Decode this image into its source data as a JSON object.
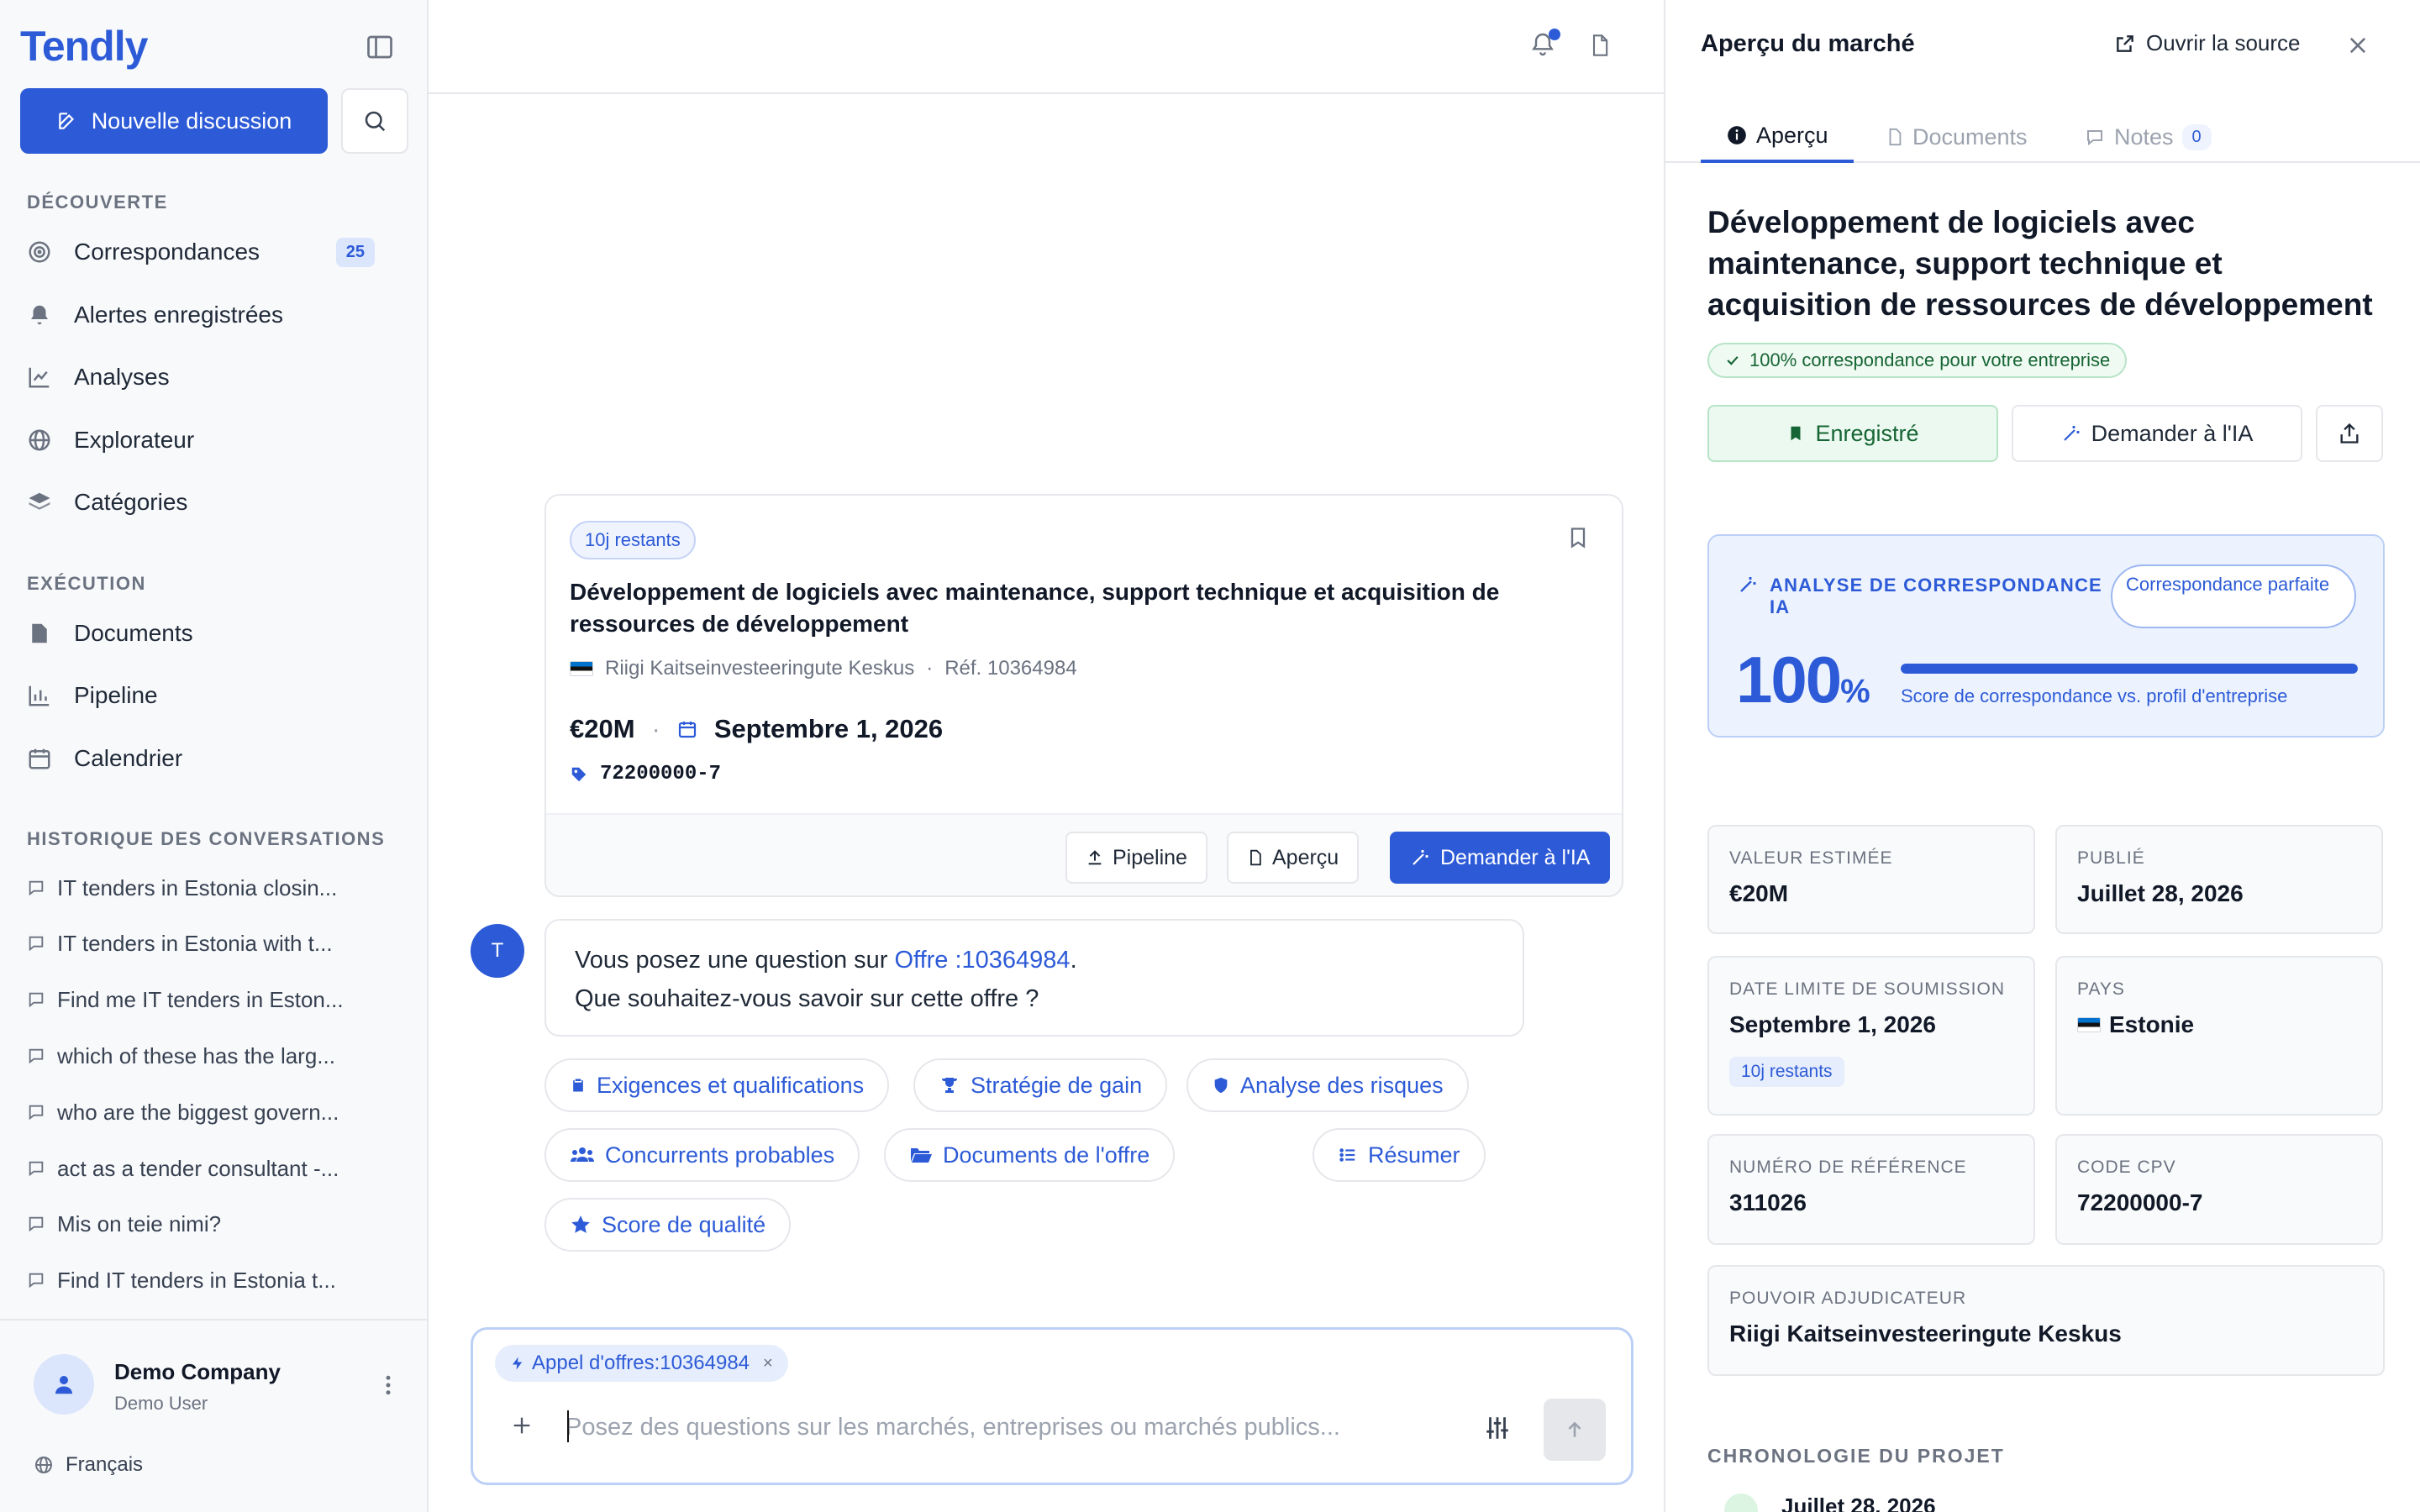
{
  "app": {
    "logo": "Tendly",
    "new_chat_label": "Nouvelle discussion"
  },
  "sidebar": {
    "discovery_heading": "DÉCOUVERTE",
    "discovery_items": [
      {
        "label": "Correspondances",
        "badge": "25"
      },
      {
        "label": "Alertes enregistrées"
      },
      {
        "label": "Analyses"
      },
      {
        "label": "Explorateur"
      },
      {
        "label": "Catégories"
      }
    ],
    "execution_heading": "EXÉCUTION",
    "execution_items": [
      {
        "label": "Documents"
      },
      {
        "label": "Pipeline"
      },
      {
        "label": "Calendrier"
      }
    ],
    "history_heading": "HISTORIQUE DES CONVERSATIONS",
    "history": [
      "IT tenders in Estonia closin...",
      "IT tenders in Estonia with t...",
      "Find me IT tenders in Eston...",
      "which of these has the larg...",
      "who are the biggest govern...",
      "act as a tender consultant -...",
      "Mis on teie nimi?",
      "Find IT tenders in Estonia t..."
    ],
    "footer": {
      "company": "Demo Company",
      "user": "Demo User",
      "language": "Français"
    }
  },
  "tender_card": {
    "days_left": "10j restants",
    "title": "Développement de logiciels avec maintenance, support technique et acquisition de ressources de développement",
    "buyer": "Riigi Kaitseinvesteeringute Keskus",
    "reference": "Réf. 10364984",
    "value": "€20M",
    "deadline": "Septembre 1, 2026",
    "cpv": "72200000-7",
    "actions": {
      "pipeline": "Pipeline",
      "preview": "Aperçu",
      "ask_ai": "Demander à l'IA"
    }
  },
  "message": {
    "avatar": "T",
    "line1_prefix": "Vous posez une question sur ",
    "link": "Offre :10364984",
    "line1_suffix": ".",
    "line2": "Que souhaitez-vous savoir sur cette offre ?"
  },
  "suggestions": [
    "Exigences et qualifications",
    "Stratégie de gain",
    "Analyse des risques",
    "Concurrents probables",
    "Documents de l'offre",
    "Résumer",
    "Score de qualité"
  ],
  "composer": {
    "chip": "Appel d'offres:10364984",
    "chip_close": "×",
    "placeholder": "Posez des questions sur les marchés, entreprises ou marchés publics...",
    "value": ""
  },
  "panel": {
    "title": "Aperçu du marché",
    "source_label": "Ouvrir la source",
    "tabs": [
      {
        "label": "Aperçu"
      },
      {
        "label": "Documents"
      },
      {
        "label": "Notes",
        "count": "0"
      }
    ],
    "tender_title": "Développement de logiciels avec maintenance, support technique et acquisition de ressources de développement",
    "match_badge": "100% correspondance pour votre entreprise",
    "saved_label": "Enregistré",
    "ask_label": "Demander à l'IA",
    "ai": {
      "label": "ANALYSE DE CORRESPONDANCE IA",
      "pill": "Correspondance parfaite",
      "score": "100",
      "unit": "%",
      "score_fraction": 1.0,
      "caption": "Score de correspondance vs. profil d'entreprise"
    },
    "facts": {
      "value_label": "VALEUR ESTIMÉE",
      "value": "€20M",
      "published_label": "PUBLIÉ",
      "published": "Juillet 28, 2026",
      "deadline_label": "DATE LIMITE DE SOUMISSION",
      "deadline": "Septembre 1, 2026",
      "deadline_pill": "10j restants",
      "country_label": "PAYS",
      "country": "Estonie",
      "ref_label": "NUMÉRO DE RÉFÉRENCE",
      "ref": "311026",
      "cpv_label": "CODE CPV",
      "cpv": "72200000-7",
      "authority_label": "POUVOIR ADJUDICATEUR",
      "authority": "Riigi Kaitseinvesteeringute Keskus"
    },
    "timeline_heading": "CHRONOLOGIE DU PROJET",
    "timeline_first": "Juillet 28, 2026"
  },
  "colors": {
    "accent": "#2d5bd7",
    "success": "#166534",
    "muted": "#6b7280"
  },
  "icons": {
    "panel_toggle": "sidebar-toggle-icon",
    "search": "search-icon",
    "bell": "bell-icon",
    "document": "document-icon",
    "bookmark": "bookmark-icon",
    "send": "arrow-up-icon"
  }
}
